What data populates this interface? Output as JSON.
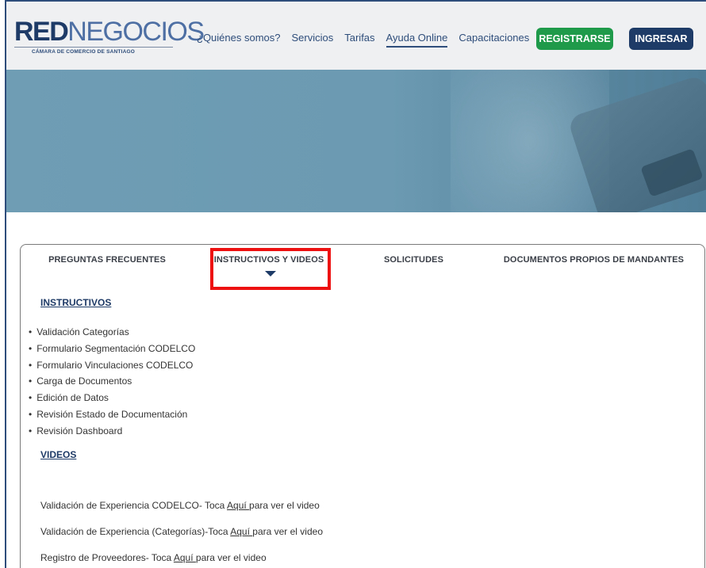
{
  "header": {
    "logo": {
      "main_red": "RED",
      "main_blue": "NEGOCIOS",
      "sub": "CÁMARA DE COMERCIO DE SANTIAGO"
    },
    "nav": [
      {
        "label": "¿Quiénes somos?",
        "active": false
      },
      {
        "label": "Servicios",
        "active": false
      },
      {
        "label": "Tarifas",
        "active": false
      },
      {
        "label": "Ayuda Online",
        "active": true
      },
      {
        "label": "Capacitaciones",
        "active": false
      }
    ],
    "register_label": "REGISTRARSE",
    "login_label": "INGRESAR"
  },
  "colors": {
    "brand_navy": "#1e3a66",
    "brand_green": "#1f9a4a",
    "highlight_red": "#ee1111"
  },
  "tabs": [
    {
      "label": "PREGUNTAS FRECUENTES"
    },
    {
      "label": "INSTRUCTIVOS Y VIDEOS",
      "selected": true
    },
    {
      "label": "SOLICITUDES"
    },
    {
      "label": "DOCUMENTOS PROPIOS DE MANDANTES"
    }
  ],
  "instructivos": {
    "heading": "INSTRUCTIVOS",
    "items": [
      "Validación Categorías",
      "Formulario Segmentación CODELCO",
      "Formulario Vinculaciones CODELCO",
      "Carga de Documentos",
      "Edición de Datos",
      "Revisión Estado de Documentación",
      "Revisión Dashboard"
    ]
  },
  "videos": {
    "heading": "VIDEOS",
    "items": [
      {
        "prefix": "Validación de Experiencia CODELCO- Toca ",
        "link": "Aquí ",
        "suffix": "para ver el video"
      },
      {
        "prefix": "Validación de Experiencia (Categorías)-Toca ",
        "link": "Aquí ",
        "suffix": "para ver el video"
      },
      {
        "prefix": "Registro de Proveedores- Toca ",
        "link": "Aquí ",
        "suffix": "para ver el video"
      }
    ]
  }
}
